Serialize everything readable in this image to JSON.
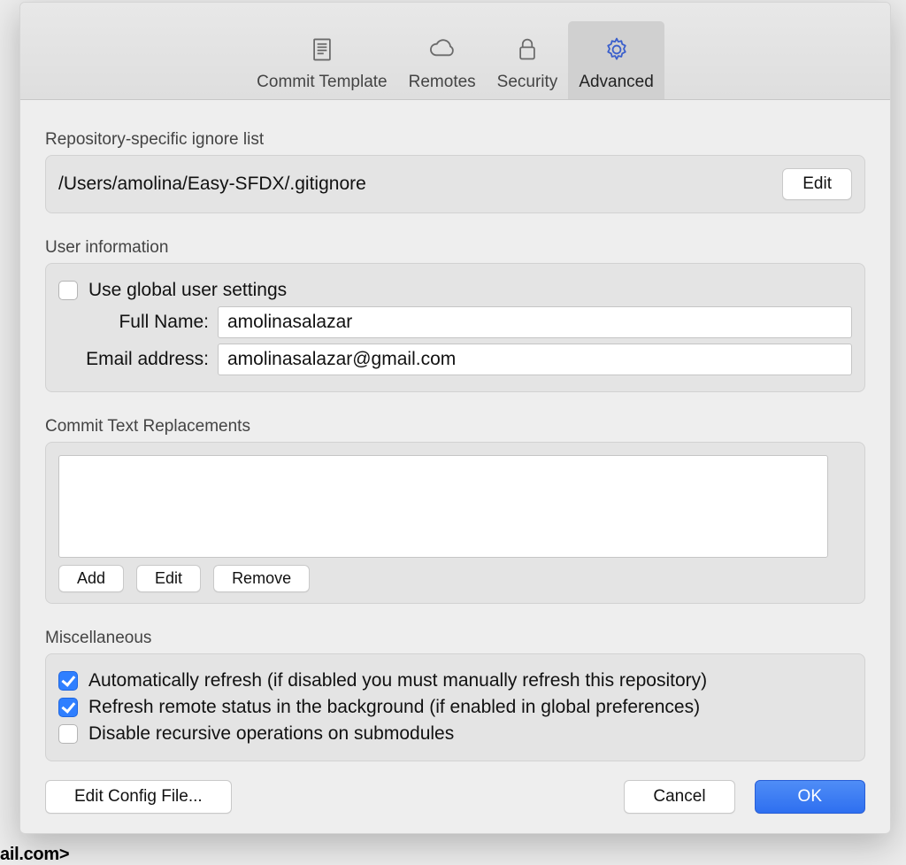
{
  "tabs": {
    "commit_template": "Commit Template",
    "remotes": "Remotes",
    "security": "Security",
    "advanced": "Advanced"
  },
  "ignore": {
    "header": "Repository-specific ignore list",
    "path": "/Users/amolina/Easy-SFDX/.gitignore",
    "edit": "Edit"
  },
  "user": {
    "header": "User information",
    "use_global": "Use global user settings",
    "full_name_label": "Full Name:",
    "full_name_value": "amolinasalazar",
    "email_label": "Email address:",
    "email_value": "amolinasalazar@gmail.com"
  },
  "replacements": {
    "header": "Commit Text Replacements",
    "add": "Add",
    "edit": "Edit",
    "remove": "Remove"
  },
  "misc": {
    "header": "Miscellaneous",
    "auto_refresh": "Automatically refresh (if disabled you must manually refresh this repository)",
    "refresh_remote": "Refresh remote status in the background (if enabled in global preferences)",
    "disable_recursive": "Disable recursive operations on submodules"
  },
  "footer": {
    "edit_config": "Edit Config File...",
    "cancel": "Cancel",
    "ok": "OK"
  },
  "background_hint": "ail.com>"
}
